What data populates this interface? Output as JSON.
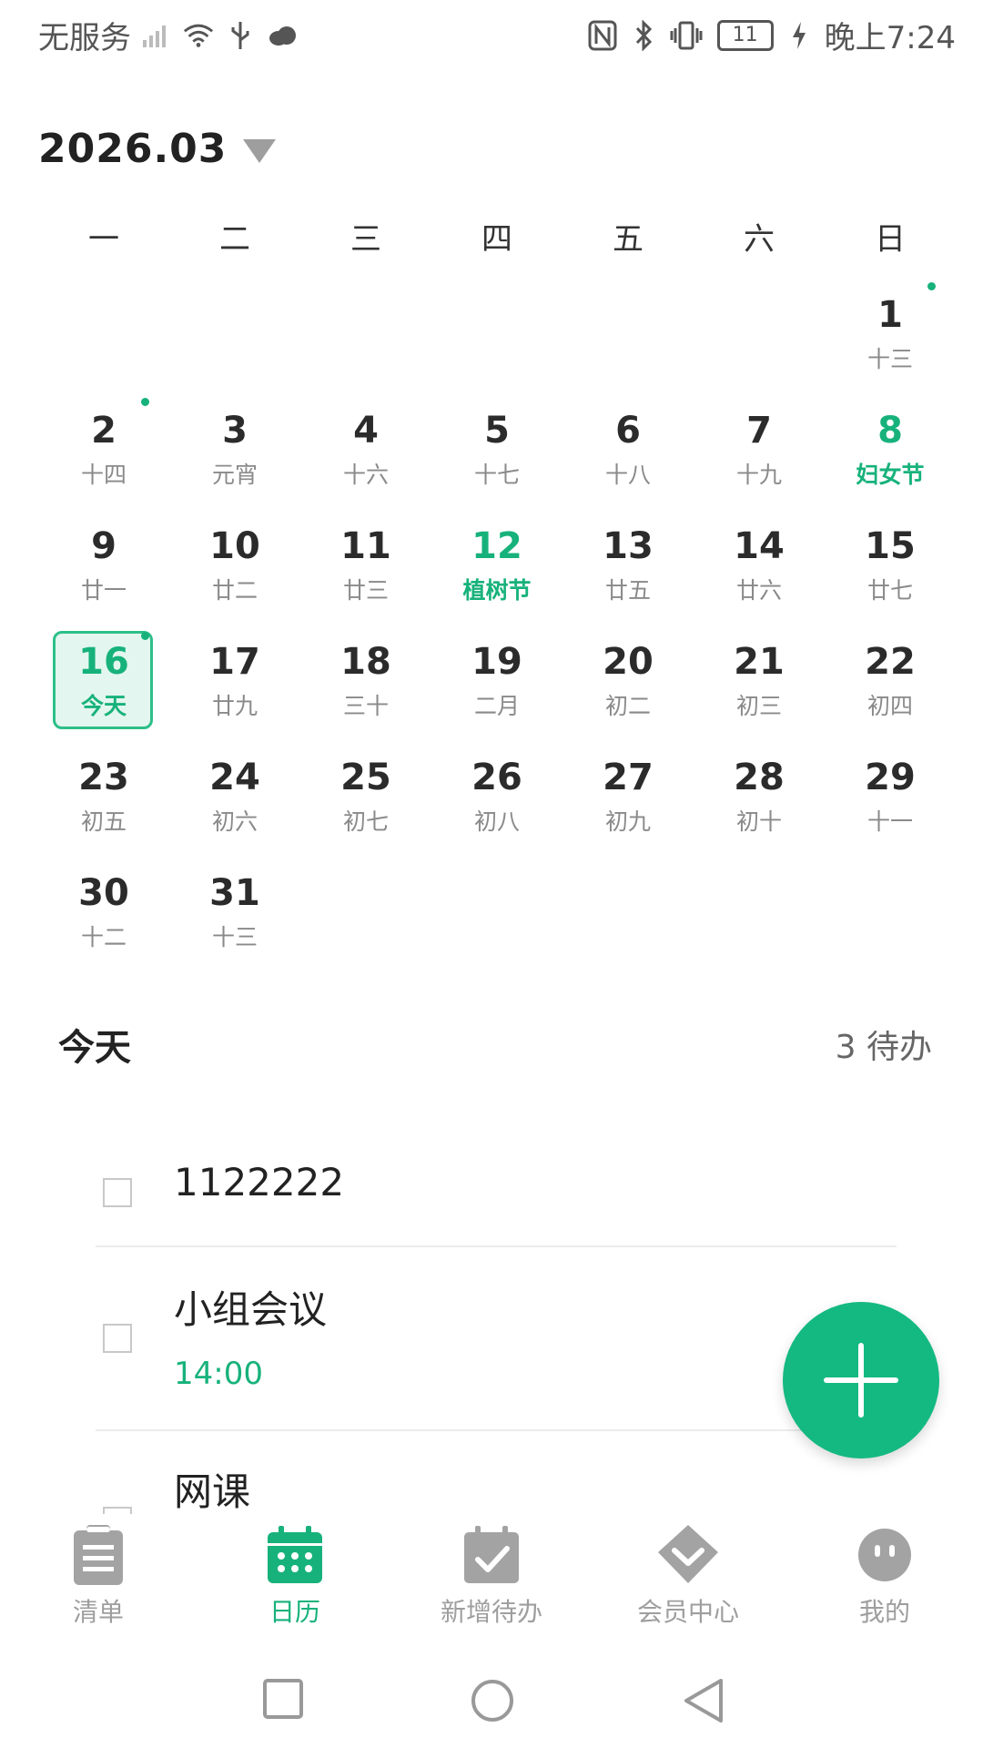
{
  "status_bar": {
    "carrier": "无服务",
    "battery": "11",
    "time": "晚上7:24",
    "icons": [
      "signal-icon",
      "wifi-icon",
      "usb-icon",
      "cloud-icon",
      "nfc-icon",
      "bluetooth-icon",
      "vibrate-icon",
      "charging-icon"
    ]
  },
  "calendar": {
    "month_label": "2026.03",
    "weekdays": [
      "一",
      "二",
      "三",
      "四",
      "五",
      "六",
      "日"
    ],
    "days": [
      {
        "day": "",
        "lunar": ""
      },
      {
        "day": "",
        "lunar": ""
      },
      {
        "day": "",
        "lunar": ""
      },
      {
        "day": "",
        "lunar": ""
      },
      {
        "day": "",
        "lunar": ""
      },
      {
        "day": "",
        "lunar": ""
      },
      {
        "day": "1",
        "lunar": "十三",
        "dot": true
      },
      {
        "day": "2",
        "lunar": "十四",
        "dot": true
      },
      {
        "day": "3",
        "lunar": "元宵"
      },
      {
        "day": "4",
        "lunar": "十六"
      },
      {
        "day": "5",
        "lunar": "十七"
      },
      {
        "day": "6",
        "lunar": "十八"
      },
      {
        "day": "7",
        "lunar": "十九"
      },
      {
        "day": "8",
        "lunar": "妇女节",
        "holiday": true
      },
      {
        "day": "9",
        "lunar": "廿一"
      },
      {
        "day": "10",
        "lunar": "廿二"
      },
      {
        "day": "11",
        "lunar": "廿三"
      },
      {
        "day": "12",
        "lunar": "植树节",
        "holiday": true
      },
      {
        "day": "13",
        "lunar": "廿五"
      },
      {
        "day": "14",
        "lunar": "廿六"
      },
      {
        "day": "15",
        "lunar": "廿七"
      },
      {
        "day": "16",
        "lunar": "今天",
        "today": true,
        "dot": true
      },
      {
        "day": "17",
        "lunar": "廿九"
      },
      {
        "day": "18",
        "lunar": "三十"
      },
      {
        "day": "19",
        "lunar": "二月"
      },
      {
        "day": "20",
        "lunar": "初二"
      },
      {
        "day": "21",
        "lunar": "初三"
      },
      {
        "day": "22",
        "lunar": "初四"
      },
      {
        "day": "23",
        "lunar": "初五"
      },
      {
        "day": "24",
        "lunar": "初六"
      },
      {
        "day": "25",
        "lunar": "初七"
      },
      {
        "day": "26",
        "lunar": "初八"
      },
      {
        "day": "27",
        "lunar": "初九"
      },
      {
        "day": "28",
        "lunar": "初十"
      },
      {
        "day": "29",
        "lunar": "十一"
      },
      {
        "day": "30",
        "lunar": "十二"
      },
      {
        "day": "31",
        "lunar": "十三"
      }
    ]
  },
  "today_section": {
    "title": "今天",
    "count": "3 待办",
    "todos": [
      {
        "title": "1122222",
        "time": ""
      },
      {
        "title": "小组会议",
        "time": "14:00"
      },
      {
        "title": "网课",
        "time": ""
      }
    ]
  },
  "bottom_nav": {
    "items": [
      {
        "label": "清单",
        "icon": "clipboard-icon"
      },
      {
        "label": "日历",
        "icon": "calendar-icon",
        "active": true
      },
      {
        "label": "新增待办",
        "icon": "calendar-check-icon"
      },
      {
        "label": "会员中心",
        "icon": "diamond-icon"
      },
      {
        "label": "我的",
        "icon": "smiley-icon"
      }
    ]
  },
  "colors": {
    "accent": "#17b27b",
    "today_bg": "#e3f6ef",
    "inactive": "#9e9e9e"
  }
}
